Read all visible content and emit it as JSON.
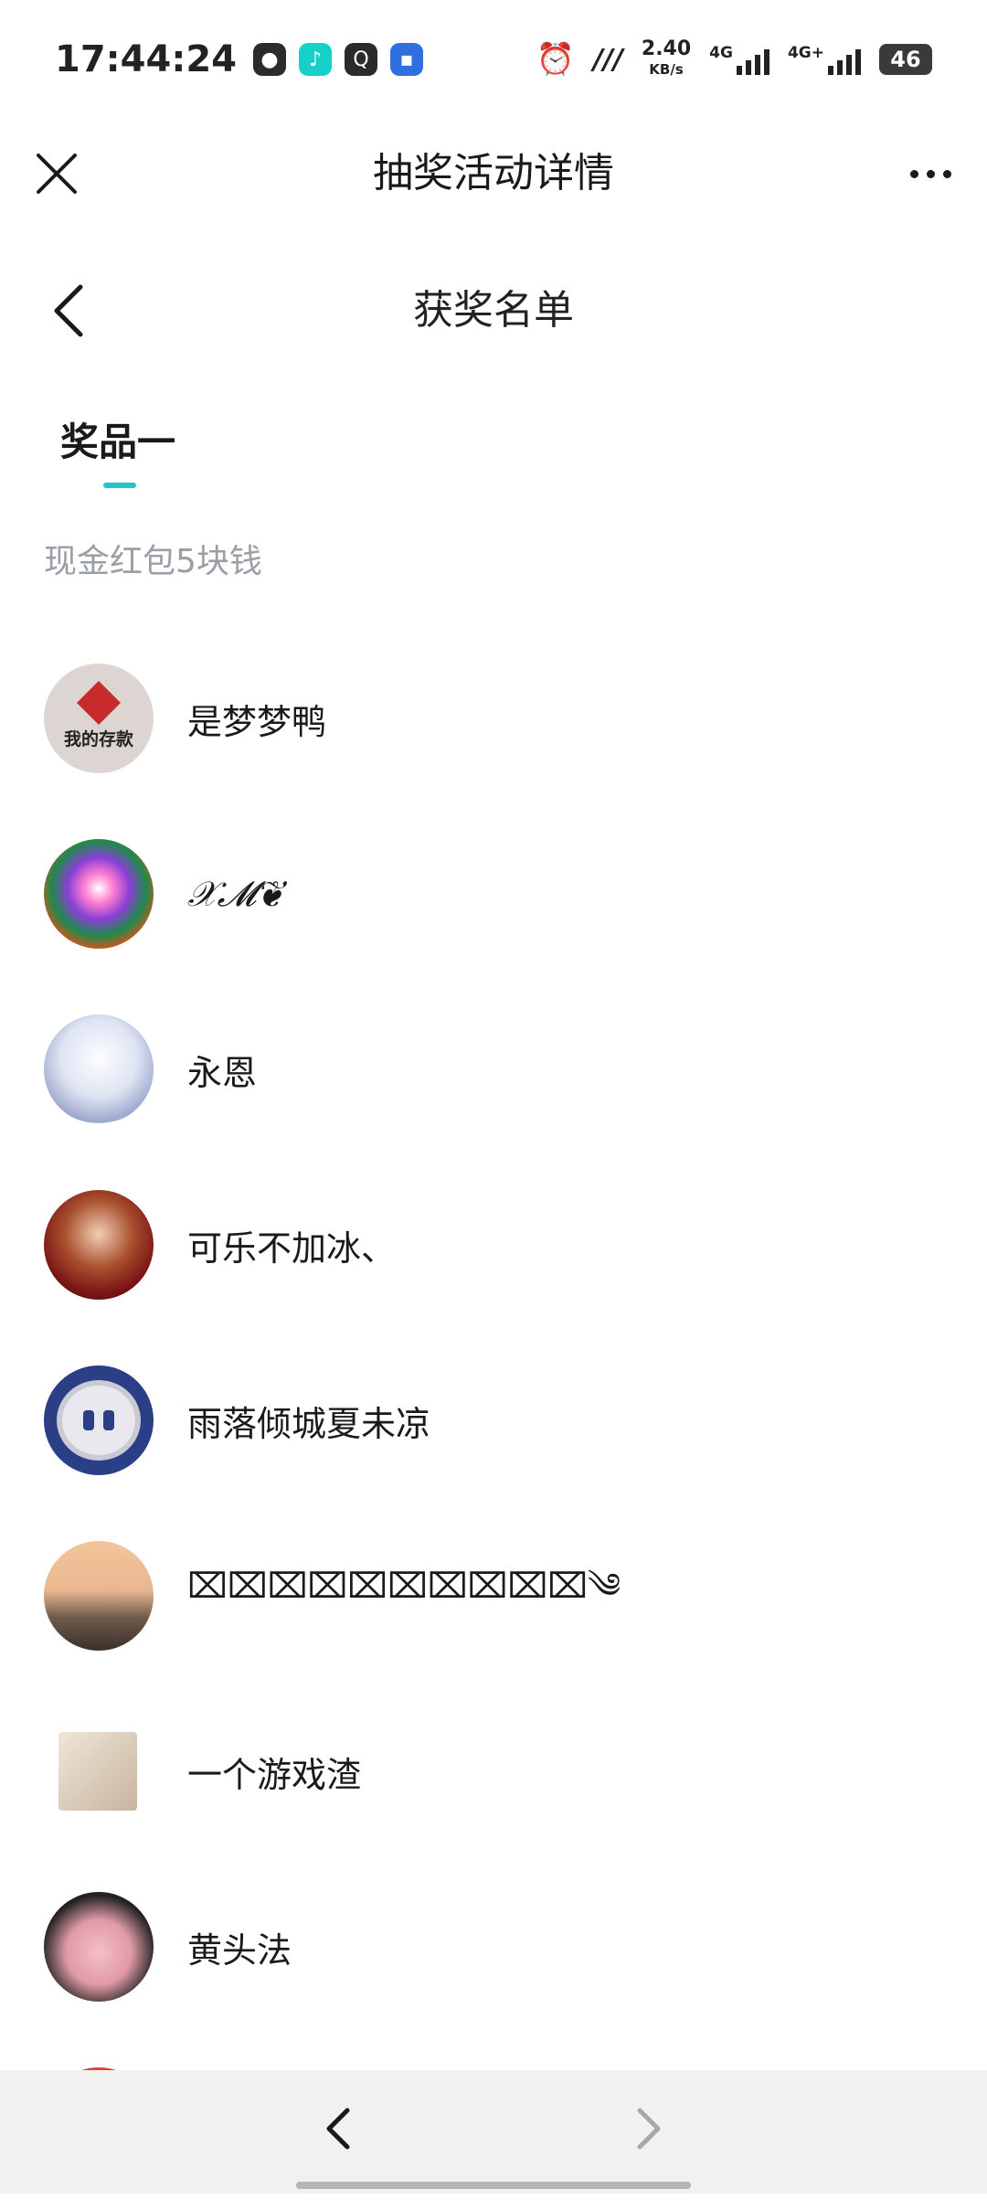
{
  "status_bar": {
    "time": "17:44:24",
    "net_speed_value": "2.40",
    "net_speed_unit": "KB/s",
    "signal1_label": "4G",
    "signal2_label": "4G+",
    "battery": "46",
    "left_icons": [
      "wechat-icon",
      "tiktok-icon",
      "quark-icon",
      "message-icon"
    ]
  },
  "topbar": {
    "title": "抽奖活动详情"
  },
  "subheader": {
    "title": "获奖名单"
  },
  "tab": {
    "label": "奖品一"
  },
  "prize": {
    "description": "现金红包5块钱"
  },
  "winners": [
    {
      "name": "是梦梦鸭",
      "avatar_text": "我的存款"
    },
    {
      "name": "𝒳𝓜❦"
    },
    {
      "name": "永恩"
    },
    {
      "name": "可乐不加冰、"
    },
    {
      "name": "雨落倾城夏未凉"
    },
    {
      "name": "⌧⌧⌧⌧⌧⌧⌧⌧⌧⌧༄"
    },
    {
      "name": "一个游戏渣"
    },
    {
      "name": "黄头法"
    }
  ],
  "colors": {
    "accent": "#21c5c4",
    "subtle_text": "#9a9fa6",
    "bottom_bar": "#f1f1f1"
  }
}
